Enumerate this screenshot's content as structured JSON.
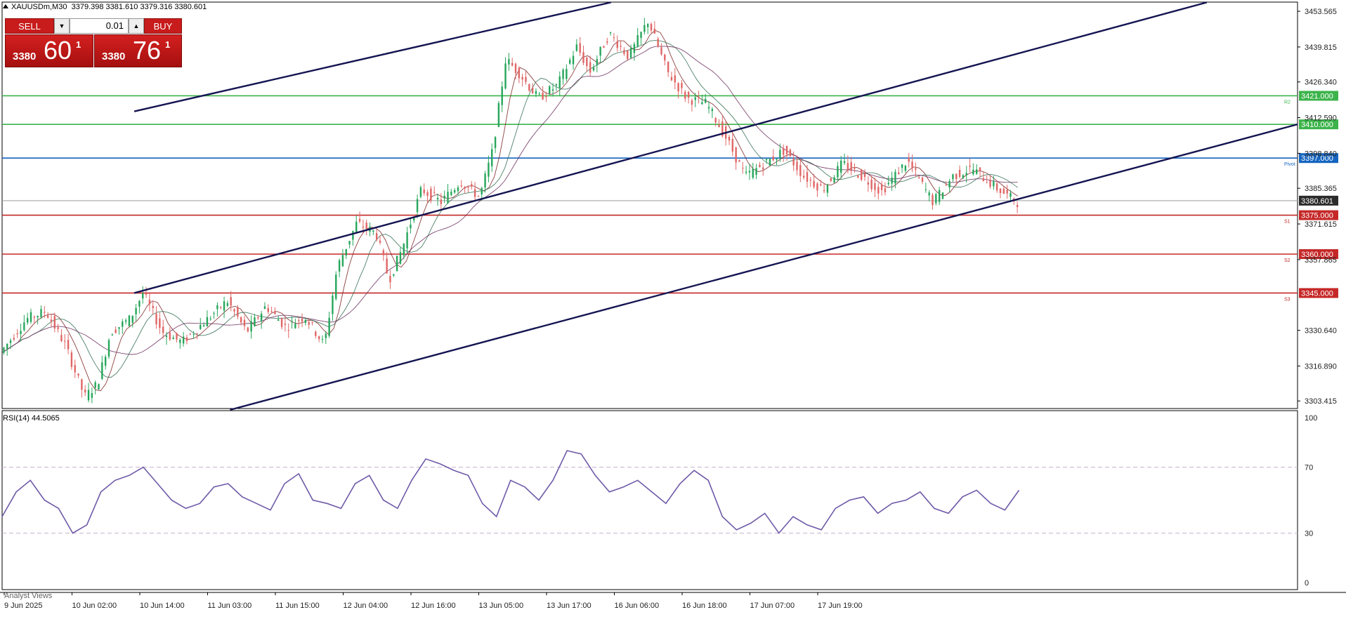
{
  "header": {
    "symbol": "XAUUSDm,M30",
    "ohlc": "3379.398 3381.610 3379.316 3380.601"
  },
  "trade_panel": {
    "sell_label": "SELL",
    "buy_label": "BUY",
    "lot_value": "0.01",
    "sell_price_small": "3380",
    "sell_price_big": "60",
    "sell_price_sup": "1",
    "buy_price_small": "3380",
    "buy_price_big": "76",
    "buy_price_sup": "1"
  },
  "chart_data": [
    {
      "type": "candlestick",
      "title": "XAUUSDm,M30",
      "price_axis_ticks": [
        "3453.565",
        "3439.815",
        "3426.340",
        "3412.590",
        "3398.840",
        "3385.365",
        "3371.615",
        "3357.865",
        "3330.640",
        "3316.890",
        "3303.415"
      ],
      "ylim": [
        3300.5,
        3457.1
      ],
      "time_axis_ticks": [
        "9 Jun 2025",
        "10 Jun 02:00",
        "10 Jun 14:00",
        "11 Jun 03:00",
        "11 Jun 15:00",
        "12 Jun 04:00",
        "12 Jun 16:00",
        "13 Jun 05:00",
        "13 Jun 17:00",
        "16 Jun 06:00",
        "16 Jun 18:00",
        "17 Jun 07:00",
        "17 Jun 19:00"
      ],
      "current_price": "3380.601",
      "horizontal_levels": [
        {
          "value": 3421.0,
          "label": "3421.000",
          "tag": "R2",
          "color": "#3cb44b"
        },
        {
          "value": 3410.0,
          "label": "3410.000",
          "tag": "",
          "color": "#3cb44b"
        },
        {
          "value": 3397.0,
          "label": "3397.000",
          "tag": "Pivot",
          "color": "#1565c0"
        },
        {
          "value": 3375.0,
          "label": "3375.000",
          "tag": "S1",
          "color": "#c62828"
        },
        {
          "value": 3360.0,
          "label": "3360.000",
          "tag": "S2",
          "color": "#c62828"
        },
        {
          "value": 3345.0,
          "label": "3345.000",
          "tag": "S3",
          "color": "#c62828"
        }
      ],
      "bull_color": "#26a65b",
      "bear_color": "#e06666",
      "price_path": [
        {
          "t": 0,
          "p": 3322
        },
        {
          "t": 0.02,
          "p": 3335
        },
        {
          "t": 0.035,
          "p": 3338
        },
        {
          "t": 0.05,
          "p": 3325
        },
        {
          "t": 0.065,
          "p": 3305
        },
        {
          "t": 0.075,
          "p": 3310
        },
        {
          "t": 0.085,
          "p": 3330
        },
        {
          "t": 0.1,
          "p": 3335
        },
        {
          "t": 0.11,
          "p": 3345
        },
        {
          "t": 0.125,
          "p": 3330
        },
        {
          "t": 0.14,
          "p": 3326
        },
        {
          "t": 0.16,
          "p": 3335
        },
        {
          "t": 0.175,
          "p": 3342
        },
        {
          "t": 0.19,
          "p": 3330
        },
        {
          "t": 0.205,
          "p": 3340
        },
        {
          "t": 0.22,
          "p": 3332
        },
        {
          "t": 0.235,
          "p": 3336
        },
        {
          "t": 0.25,
          "p": 3325
        },
        {
          "t": 0.26,
          "p": 3355
        },
        {
          "t": 0.275,
          "p": 3372
        },
        {
          "t": 0.29,
          "p": 3368
        },
        {
          "t": 0.3,
          "p": 3350
        },
        {
          "t": 0.31,
          "p": 3362
        },
        {
          "t": 0.325,
          "p": 3385
        },
        {
          "t": 0.34,
          "p": 3380
        },
        {
          "t": 0.355,
          "p": 3388
        },
        {
          "t": 0.37,
          "p": 3382
        },
        {
          "t": 0.38,
          "p": 3400
        },
        {
          "t": 0.39,
          "p": 3435
        },
        {
          "t": 0.4,
          "p": 3430
        },
        {
          "t": 0.415,
          "p": 3420
        },
        {
          "t": 0.43,
          "p": 3425
        },
        {
          "t": 0.445,
          "p": 3440
        },
        {
          "t": 0.455,
          "p": 3430
        },
        {
          "t": 0.47,
          "p": 3445
        },
        {
          "t": 0.485,
          "p": 3436
        },
        {
          "t": 0.5,
          "p": 3450
        },
        {
          "t": 0.515,
          "p": 3430
        },
        {
          "t": 0.53,
          "p": 3420
        },
        {
          "t": 0.545,
          "p": 3418
        },
        {
          "t": 0.56,
          "p": 3405
        },
        {
          "t": 0.575,
          "p": 3390
        },
        {
          "t": 0.59,
          "p": 3395
        },
        {
          "t": 0.605,
          "p": 3400
        },
        {
          "t": 0.62,
          "p": 3390
        },
        {
          "t": 0.635,
          "p": 3385
        },
        {
          "t": 0.65,
          "p": 3395
        },
        {
          "t": 0.665,
          "p": 3390
        },
        {
          "t": 0.68,
          "p": 3384
        },
        {
          "t": 0.7,
          "p": 3396
        },
        {
          "t": 0.72,
          "p": 3380
        },
        {
          "t": 0.735,
          "p": 3390
        },
        {
          "t": 0.75,
          "p": 3393
        },
        {
          "t": 0.77,
          "p": 3385
        },
        {
          "t": 0.785,
          "p": 3380
        }
      ],
      "channel_lines": [
        {
          "x1": 0.102,
          "y1": 3415,
          "x2": 0.47,
          "y2": 3457
        },
        {
          "x1": 0.102,
          "y1": 3345,
          "x2": 0.93,
          "y2": 3457
        },
        {
          "x1": 0.176,
          "y1": 3300,
          "x2": 1.0,
          "y2": 3410
        }
      ]
    },
    {
      "type": "line",
      "title": "RSI(14) 44.5065",
      "ylim": [
        0,
        100
      ],
      "ticks": [
        "100",
        "70",
        "30",
        "0"
      ],
      "levels": [
        70,
        30
      ],
      "values": [
        40,
        55,
        62,
        50,
        45,
        30,
        35,
        55,
        62,
        65,
        70,
        60,
        50,
        45,
        48,
        58,
        60,
        52,
        48,
        44,
        60,
        66,
        50,
        48,
        45,
        60,
        65,
        50,
        45,
        62,
        75,
        72,
        68,
        65,
        48,
        40,
        62,
        58,
        50,
        62,
        80,
        78,
        65,
        55,
        58,
        62,
        55,
        48,
        60,
        68,
        62,
        40,
        32,
        36,
        42,
        30,
        40,
        35,
        32,
        45,
        50,
        52,
        42,
        48,
        50,
        55,
        45,
        42,
        52,
        56,
        48,
        44,
        56
      ]
    }
  ],
  "bottom": {
    "analyst_views": "Analyst Views"
  }
}
